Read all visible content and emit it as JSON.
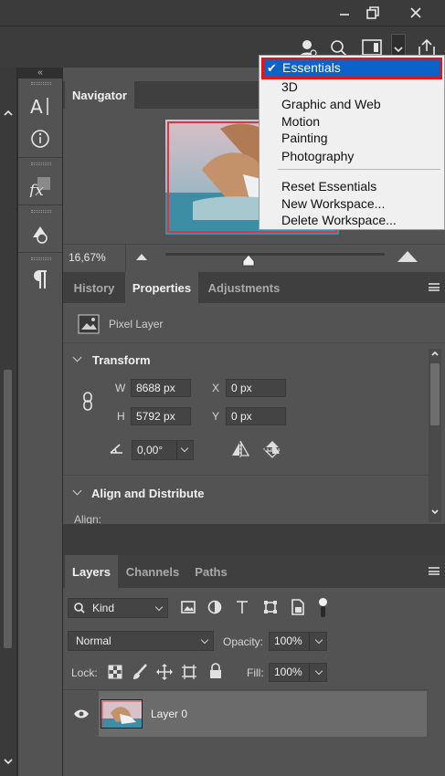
{
  "window_controls": {
    "minimize": "minimize-icon",
    "restore": "restore-icon",
    "close": "close-icon"
  },
  "toolbar_icons": [
    "user-icon",
    "search-icon",
    "workspace-icon",
    "chevron-down-icon",
    "share-icon"
  ],
  "side_strip": {
    "collapse_glyph": "«",
    "icons": [
      "character-icon",
      "info-icon",
      "fx-icon",
      "brush-preset-icon",
      "paragraph-icon"
    ]
  },
  "navigator": {
    "tab": "Navigator",
    "zoom": "16,67%"
  },
  "properties_tabs": {
    "tabs": [
      "History",
      "Properties",
      "Adjustments"
    ],
    "active": "Properties"
  },
  "properties": {
    "layer_type": "Pixel Layer",
    "transform_title": "Transform",
    "w_label": "W",
    "w_value": "8688 px",
    "x_label": "X",
    "x_value": "0 px",
    "h_label": "H",
    "h_value": "5792 px",
    "y_label": "Y",
    "y_value": "0 px",
    "angle_value": "0,00°",
    "align_title": "Align and Distribute",
    "align_label": "Align:"
  },
  "layers_tabs": {
    "tabs": [
      "Layers",
      "Channels",
      "Paths"
    ],
    "active": "Layers"
  },
  "layers": {
    "filter_kind": "Kind",
    "blend_mode": "Normal",
    "opacity_label": "Opacity:",
    "opacity_value": "100%",
    "lock_label": "Lock:",
    "fill_label": "Fill:",
    "fill_value": "100%",
    "layer_name": "Layer 0"
  },
  "workspace_menu": {
    "selected": "Essentials",
    "items": [
      "3D",
      "Graphic and Web",
      "Motion",
      "Painting",
      "Photography"
    ],
    "actions": [
      "Reset Essentials",
      "New Workspace...",
      "Delete Workspace..."
    ],
    "highlight_color": "#0a64c8",
    "outline_color": "#e3151b"
  }
}
